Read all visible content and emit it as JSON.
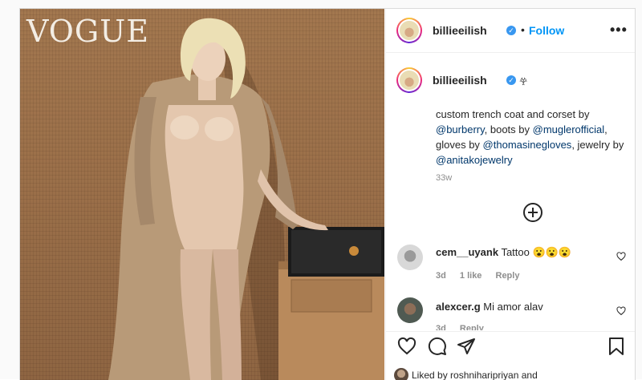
{
  "photo": {
    "magazine_logo": "VOGUE"
  },
  "header": {
    "username": "billieeilish",
    "separator": "•",
    "follow_label": "Follow",
    "more_label": "•••"
  },
  "caption": {
    "username": "billieeilish",
    "emoji": "𖣂",
    "text_1": "custom trench coat and corset by",
    "mention_1": "@burberry",
    "text_2": ", boots by ",
    "mention_2": "@muglerofficial",
    "text_3": ",",
    "text_4": "gloves by ",
    "mention_3": "@thomasinegloves",
    "text_5": ", jewelry by",
    "mention_4": "@anitakojewelry",
    "age": "33w"
  },
  "comments": [
    {
      "username": "cem__uyank",
      "text": "Tattoo 😮😮😮",
      "age": "3d",
      "likes": "1 like",
      "reply": "Reply"
    },
    {
      "username": "alexcer.g",
      "text": "Mi amor alav",
      "age": "3d",
      "likes": "",
      "reply": "Reply"
    }
  ],
  "footer": {
    "liked_by": "Liked by roshniharipriyan and"
  },
  "colors": {
    "accent": "#0095f6",
    "verified": "#3897f0",
    "muted": "#8e8e8e"
  }
}
